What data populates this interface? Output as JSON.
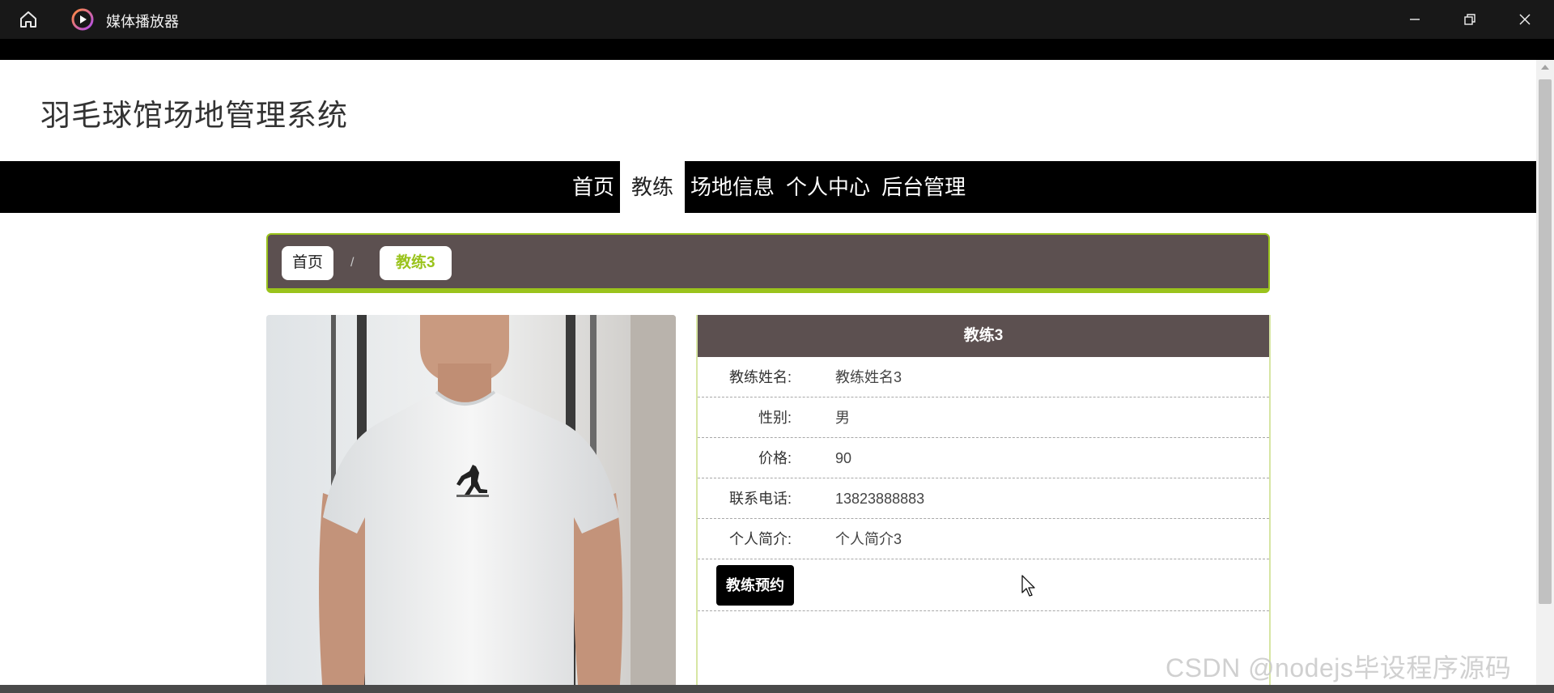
{
  "window": {
    "app_title": "媒体播放器"
  },
  "site": {
    "title": "羽毛球馆场地管理系统"
  },
  "nav": {
    "items": [
      {
        "label": "首页"
      },
      {
        "label": "教练"
      },
      {
        "label": "场地信息"
      },
      {
        "label": "个人中心"
      },
      {
        "label": "后台管理"
      }
    ],
    "active": "教练"
  },
  "breadcrumb": {
    "home": "首页",
    "separator": "/",
    "current": "教练3"
  },
  "detail": {
    "title": "教练3",
    "fields": [
      {
        "label": "教练姓名:",
        "value": "教练姓名3"
      },
      {
        "label": "性别:",
        "value": "男"
      },
      {
        "label": "价格:",
        "value": "90"
      },
      {
        "label": "联系电话:",
        "value": "13823888883"
      },
      {
        "label": "个人简介:",
        "value": "个人简介3"
      }
    ],
    "book_button": "教练预约"
  },
  "watermark": "CSDN @nodejs毕设程序源码",
  "colors": {
    "accent": "#9ac31c",
    "panel": "#5c5050",
    "nav": "#000000"
  }
}
